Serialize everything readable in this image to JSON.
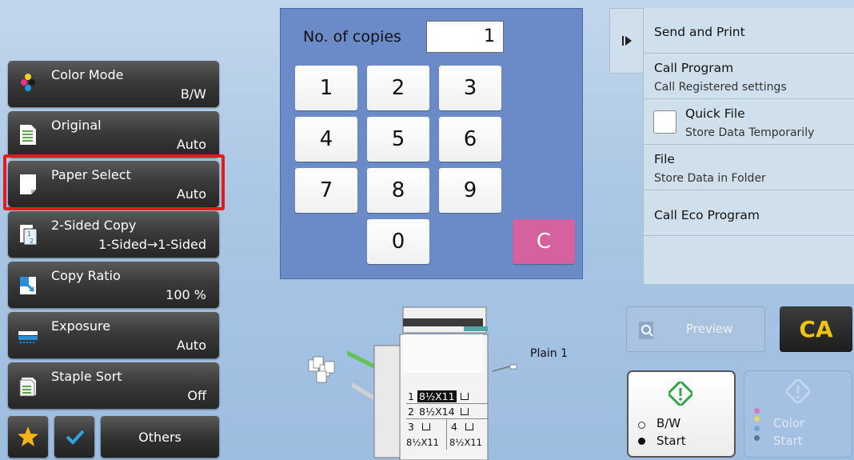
{
  "functions": [
    {
      "label": "Color Mode",
      "value": "B/W"
    },
    {
      "label": "Original",
      "value": "Auto"
    },
    {
      "label": "Paper Select",
      "value": "Auto"
    },
    {
      "label": "2-Sided Copy",
      "value": "1-Sided→1-Sided"
    },
    {
      "label": "Copy Ratio",
      "value": "100 %"
    },
    {
      "label": "Exposure",
      "value": "Auto"
    },
    {
      "label": "Staple Sort",
      "value": "Off"
    }
  ],
  "bottom_bar": {
    "others_label": "Others"
  },
  "copies": {
    "label": "No. of copies",
    "value": "1"
  },
  "keypad": {
    "keys": [
      "1",
      "2",
      "3",
      "4",
      "5",
      "6",
      "7",
      "8",
      "9",
      "0"
    ],
    "clear_label": "C"
  },
  "right_panel": {
    "send_and_print": "Send and Print",
    "call_program": "Call Program",
    "call_program_sub": "Call Registered settings",
    "quick_file": "Quick File",
    "quick_file_sub": "Store Data Temporarily",
    "file": "File",
    "file_sub": "Store Data in Folder",
    "call_eco_program": "Call Eco Program"
  },
  "preview_label": "Preview",
  "ca_label": "CA",
  "start": {
    "bw_label": "B/W",
    "bw_start": "Start",
    "color_label": "Color",
    "color_start": "Start"
  },
  "machine": {
    "tray_label": "Plain 1",
    "trays": [
      {
        "num": "1",
        "size": "8½X11"
      },
      {
        "num": "2",
        "size": "8½X14"
      },
      {
        "num": "3",
        "size": "8½X11"
      },
      {
        "num": "4",
        "size": "8½X11"
      }
    ]
  },
  "colors": {
    "highlight": "#e21c1c",
    "clear_key": "#d6619f",
    "ca_button": "#f1c40f",
    "start_icon": "#33a84a",
    "keypad_bg": "#6b8bc8"
  }
}
